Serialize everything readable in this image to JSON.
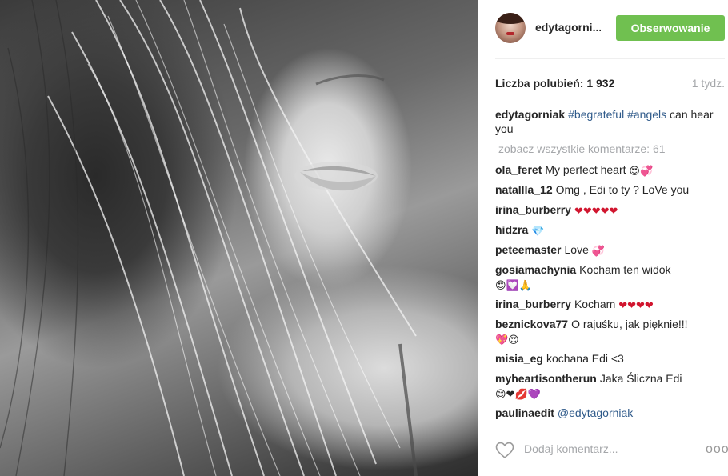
{
  "post": {
    "photo_alt": "",
    "author": {
      "username": "edytagorni...",
      "follow_label": "Obserwowanie"
    },
    "likes_text": "Liczba polubień: 1 932",
    "time_ago": "1 tydz.",
    "caption": {
      "user": "edytagorniak",
      "tag1": "#begrateful",
      "tag2": "#angels",
      "text": "can hear you"
    },
    "view_all": "zobacz wszystkie komentarze: 61",
    "comments": [
      {
        "user": "ola_feret",
        "text": "My perfect heart",
        "emoji": "😍💞"
      },
      {
        "user": "natallla_12",
        "text": "Omg , Edi to ty ? LoVe you",
        "emoji": ""
      },
      {
        "user": "irina_burberry",
        "text": "",
        "emoji": "❤❤❤❤❤"
      },
      {
        "user": "hidzra",
        "text": "",
        "emoji": "💎"
      },
      {
        "user": "peteemaster",
        "text": "Love",
        "emoji": "💞"
      },
      {
        "user": "gosiamachynia",
        "text": "Kocham ten widok",
        "emoji": "😍💟🙏"
      },
      {
        "user": "irina_burberry",
        "text": "Kocham",
        "emoji": "❤❤❤❤"
      },
      {
        "user": "beznickova77",
        "text": "O rajuśku, jak pięknie!!!",
        "emoji": "💖😍"
      },
      {
        "user": "misia_eg",
        "text": "kochana Edi <3",
        "emoji": ""
      },
      {
        "user": "myheartisontherun",
        "text": "Jaka Śliczna Edi",
        "emoji": "😊❤💋💜"
      },
      {
        "user": "paulinaedit",
        "text": "@edytagorniak",
        "emoji": ""
      }
    ],
    "add_comment_placeholder": "Dodaj komentarz...",
    "more_label": "ooo"
  },
  "colors": {
    "follow_button": "#70c050",
    "hashtag": "#2f5a8a",
    "muted": "#a5a7aa"
  },
  "icons": [
    "heart-outline-icon",
    "more-options-icon"
  ]
}
